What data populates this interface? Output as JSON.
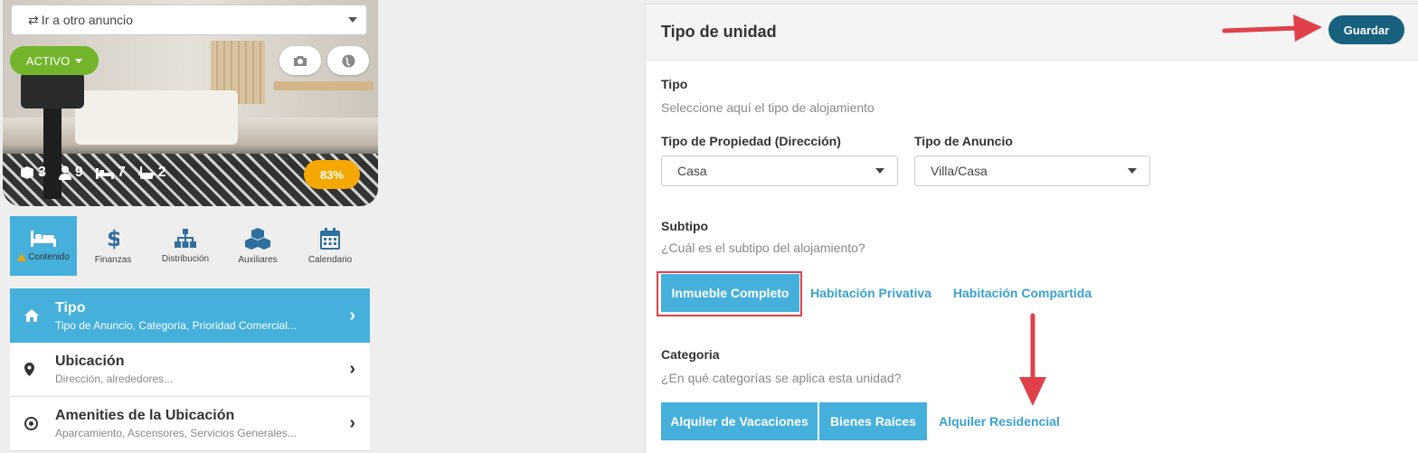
{
  "left": {
    "goto_label": "Ir a otro anuncio",
    "status": "ACTIVO",
    "stats": [
      {
        "icon": "cube-icon",
        "value": "3"
      },
      {
        "icon": "user-icon",
        "value": "9"
      },
      {
        "icon": "bed-icon",
        "value": "7"
      },
      {
        "icon": "bath-icon",
        "value": "2"
      }
    ],
    "completion": "83%",
    "tabs": [
      {
        "icon": "bed-icon",
        "label": "Contenido"
      },
      {
        "icon": "dollar-icon",
        "label": "Finanzas"
      },
      {
        "icon": "sitemap-icon",
        "label": "Distribución"
      },
      {
        "icon": "cubes-icon",
        "label": "Auxiliares"
      },
      {
        "icon": "calendar-icon",
        "label": "Calendario"
      }
    ],
    "menu": [
      {
        "icon": "home-icon",
        "title": "Tipo",
        "subtitle": "Tipo de Anuncio, Categoría, Prioridad Comercial..."
      },
      {
        "icon": "map-pin-icon",
        "title": "Ubicación",
        "subtitle": "Dirección, alrededores..."
      },
      {
        "icon": "target-icon",
        "title": "Amenities de la Ubicación",
        "subtitle": "Aparcamiento, Ascensores, Servicios Generales..."
      }
    ]
  },
  "card": {
    "title": "Tipo de unidad",
    "save_label": "Guardar",
    "tipo_heading": "Tipo",
    "tipo_help": "Seleccione aquí el tipo de alojamiento",
    "property_type_label": "Tipo de Propiedad (Dirección)",
    "property_type_value": "Casa",
    "listing_type_label": "Tipo de Anuncio",
    "listing_type_value": "Villa/Casa",
    "subtipo_heading": "Subtipo",
    "subtipo_help": "¿Cuál es el subtipo del alojamiento?",
    "subtipos": [
      "Inmueble Completo",
      "Habitación Privativa",
      "Habitación Compartida"
    ],
    "categoria_heading": "Categoria",
    "categoria_help": "¿En qué categorías se aplica esta unidad?",
    "categorias": [
      "Alquiler de Vacaciones",
      "Bienes Raíces",
      "Alquiler Residencial"
    ]
  },
  "colors": {
    "active_blue": "#45b0dc",
    "save_button": "#17607e",
    "status_green": "#72b52b",
    "completion_orange": "#f5a800",
    "annotation_red": "#e0404a"
  }
}
